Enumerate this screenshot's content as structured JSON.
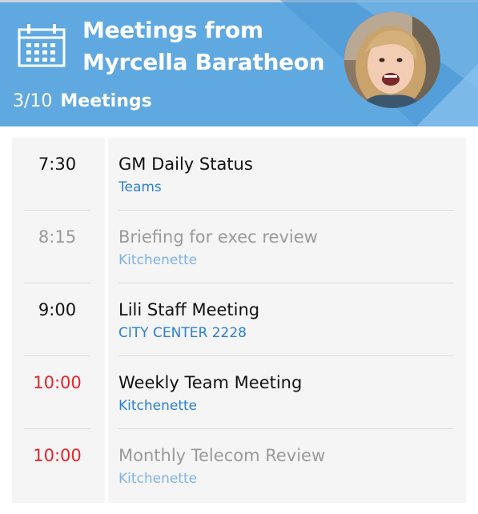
{
  "header": {
    "title_line1": "Meetings from",
    "title_line2": "Myrcella Baratheon",
    "count": "3/10",
    "count_label": "Meetings",
    "icon": "calendar-icon",
    "avatar": "profile-photo-avatar"
  },
  "colors": {
    "header_bg": "#5fa8e0",
    "accent_blue": "#2b7fd3",
    "late_red": "#e8242a",
    "dim_gray": "#9a9a9a",
    "panel_bg": "#f5f5f5"
  },
  "meetings": [
    {
      "time": "7:30",
      "title": "GM Daily Status",
      "location": "Teams",
      "state": "active"
    },
    {
      "time": "8:15",
      "title": "Briefing for exec review",
      "location": "Kitchenette",
      "state": "dimmed"
    },
    {
      "time": "9:00",
      "title": "Lili Staff Meeting",
      "location": "CITY CENTER 2228",
      "state": "active"
    },
    {
      "time": "10:00",
      "title": "Weekly Team Meeting",
      "location": "Kitchenette",
      "state": "late"
    },
    {
      "time": "10:00",
      "title": "Monthly Telecom Review",
      "location": "Kitchenette",
      "state": "late-dimmed"
    }
  ]
}
